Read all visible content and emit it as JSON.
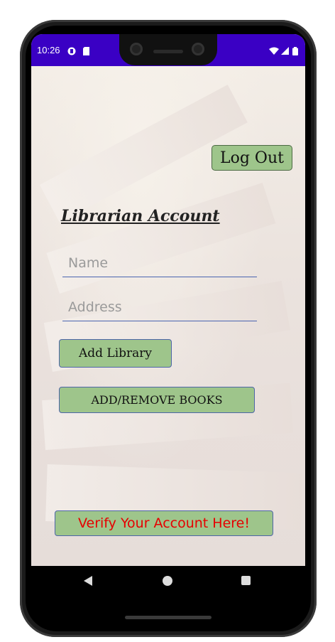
{
  "status_bar": {
    "time": "10:26",
    "bg_color": "#3a00c4"
  },
  "header": {
    "logout_label": "Log Out"
  },
  "form": {
    "title": "Librarian Account",
    "name_placeholder": "Name",
    "address_placeholder": "Address",
    "name_value": "",
    "address_value": ""
  },
  "actions": {
    "add_library_label": "Add Library",
    "add_remove_books_label": "ADD/REMOVE BOOKS",
    "verify_label": "Verify Your Account Here!"
  },
  "colors": {
    "button_green": "#9ec58b",
    "verify_text": "#e60000"
  }
}
